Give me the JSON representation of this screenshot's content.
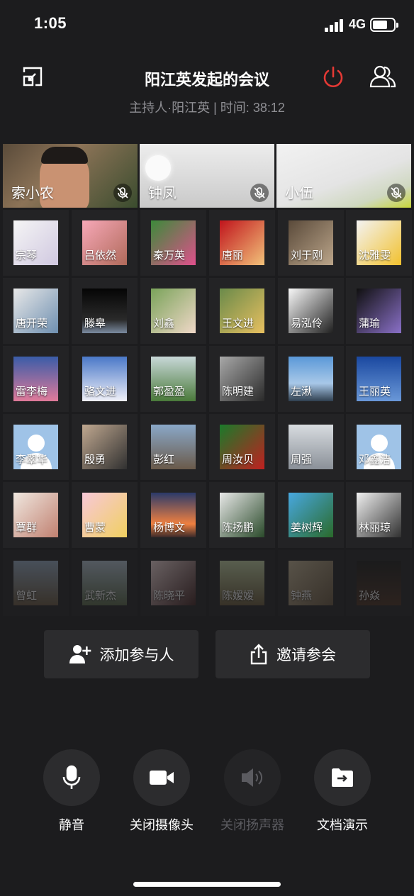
{
  "status": {
    "time": "1:05",
    "network": "4G"
  },
  "header": {
    "title": "阳江英发起的会议",
    "subtitle": "主持人·阳江英 | 时间: 38:12",
    "end_color": "#e53935"
  },
  "videos": [
    {
      "name": "索小农"
    },
    {
      "name": "钟凤"
    },
    {
      "name": "小伍"
    }
  ],
  "participants": [
    {
      "name": "宗琴",
      "bg": "linear-gradient(135deg,#f5f5f5,#d0c8e0)"
    },
    {
      "name": "吕依然",
      "bg": "linear-gradient(135deg,#f7a8b8,#b06a5a)"
    },
    {
      "name": "秦万英",
      "bg": "linear-gradient(135deg,#3c8a3a,#e0508c)"
    },
    {
      "name": "唐丽",
      "bg": "linear-gradient(135deg,#c0141c,#f2c27a)"
    },
    {
      "name": "刘于刚",
      "bg": "linear-gradient(135deg,#5a4a3a,#bba58a)"
    },
    {
      "name": "沈雅雯",
      "bg": "linear-gradient(135deg,#f3f3f3,#f2c12e)"
    },
    {
      "name": "唐开荣",
      "bg": "linear-gradient(135deg,#e8e8e8,#6e8fb0)"
    },
    {
      "name": "滕皋",
      "bg": "linear-gradient(180deg,#050505,#2a2a2a 70%,#7a8aa0)"
    },
    {
      "name": "刘鑫",
      "bg": "linear-gradient(135deg,#7aa35a,#f0d8c8)"
    },
    {
      "name": "王文进",
      "bg": "linear-gradient(135deg,#6a8a4a,#e8c060)"
    },
    {
      "name": "易泓伶",
      "bg": "linear-gradient(135deg,#f8f8f8,#202020)"
    },
    {
      "name": "蒲瑜",
      "bg": "linear-gradient(135deg,#101010,#8a70c8)"
    },
    {
      "name": "雷李梅",
      "bg": "linear-gradient(180deg,#3a5ca8,#e07a9a)"
    },
    {
      "name": "骆文进",
      "bg": "linear-gradient(180deg,#4a78c8,#f0f0f8)"
    },
    {
      "name": "郭盈盈",
      "bg": "linear-gradient(180deg,#c8d8d8,#4a7a3a)"
    },
    {
      "name": "陈明建",
      "bg": "linear-gradient(135deg,#a8a8a8,#2a2a2a)"
    },
    {
      "name": "左湫",
      "bg": "linear-gradient(180deg,#5a98d8,#a8c8e8 60%,#304050)"
    },
    {
      "name": "王丽英",
      "bg": "linear-gradient(180deg,#1a48a0,#6a98d8)"
    },
    {
      "name": "李翠华",
      "bg": "#9fc3e7",
      "default": true
    },
    {
      "name": "殷勇",
      "bg": "linear-gradient(135deg,#c0a890,#303030)"
    },
    {
      "name": "彭红",
      "bg": "linear-gradient(180deg,#8aa8c8,#6a5a4a)"
    },
    {
      "name": "周汝贝",
      "bg": "linear-gradient(135deg,#1a7a2a,#c02020)"
    },
    {
      "name": "周强",
      "bg": "linear-gradient(180deg,#d8dce0,#8a9098)"
    },
    {
      "name": "邓鑫洁",
      "bg": "#9fc3e7",
      "default": true
    },
    {
      "name": "覃群",
      "bg": "linear-gradient(135deg,#f0e8e0,#c08070)"
    },
    {
      "name": "曹蒙",
      "bg": "linear-gradient(135deg,#f8c8d8,#f0d060)"
    },
    {
      "name": "杨博文",
      "bg": "linear-gradient(180deg,#2a3a6a,#f08040 70%,#3a2a2a)"
    },
    {
      "name": "陈扬鹏",
      "bg": "linear-gradient(135deg,#e8e8e8,#2a4a2a)"
    },
    {
      "name": "姜树辉",
      "bg": "linear-gradient(135deg,#48a8e0,#2a6a2a)"
    },
    {
      "name": "林丽琼",
      "bg": "linear-gradient(135deg,#f0f0f0,#303030)"
    },
    {
      "name": "曾虹",
      "bg": "linear-gradient(180deg,#9ab0c8,#6a5840)"
    },
    {
      "name": "武新杰",
      "bg": "linear-gradient(180deg,#b8c8d8,#5a6a4a)"
    },
    {
      "name": "陈晓平",
      "bg": "linear-gradient(135deg,#f8e0e0,#402020)"
    },
    {
      "name": "陈嫒嫒",
      "bg": "linear-gradient(180deg,#c8d8a8,#6a5a3a)"
    },
    {
      "name": "钟燕",
      "bg": "linear-gradient(135deg,#c8b898,#6a5840)"
    },
    {
      "name": "孙焱",
      "bg": "linear-gradient(180deg,#1a1a1a,#4a3020)"
    }
  ],
  "actions": {
    "add_label": "添加参与人",
    "invite_label": "邀请参会"
  },
  "controls": {
    "mute_label": "静音",
    "camera_label": "关闭摄像头",
    "speaker_label": "关闭扬声器",
    "share_label": "文档演示"
  }
}
